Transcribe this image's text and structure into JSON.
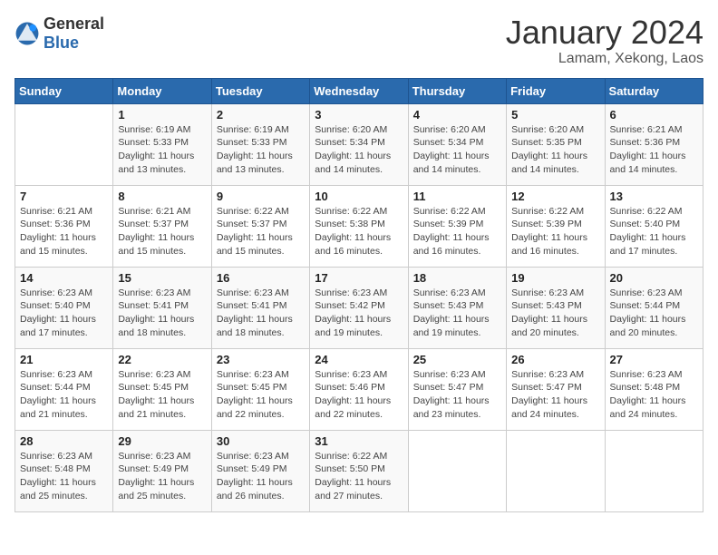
{
  "header": {
    "logo_general": "General",
    "logo_blue": "Blue",
    "month": "January 2024",
    "location": "Lamam, Xekong, Laos"
  },
  "days_of_week": [
    "Sunday",
    "Monday",
    "Tuesday",
    "Wednesday",
    "Thursday",
    "Friday",
    "Saturday"
  ],
  "weeks": [
    [
      {
        "day": "",
        "sunrise": "",
        "sunset": "",
        "daylight": ""
      },
      {
        "day": "1",
        "sunrise": "6:19 AM",
        "sunset": "5:33 PM",
        "daylight": "11 hours and 13 minutes."
      },
      {
        "day": "2",
        "sunrise": "6:19 AM",
        "sunset": "5:33 PM",
        "daylight": "11 hours and 13 minutes."
      },
      {
        "day": "3",
        "sunrise": "6:20 AM",
        "sunset": "5:34 PM",
        "daylight": "11 hours and 14 minutes."
      },
      {
        "day": "4",
        "sunrise": "6:20 AM",
        "sunset": "5:34 PM",
        "daylight": "11 hours and 14 minutes."
      },
      {
        "day": "5",
        "sunrise": "6:20 AM",
        "sunset": "5:35 PM",
        "daylight": "11 hours and 14 minutes."
      },
      {
        "day": "6",
        "sunrise": "6:21 AM",
        "sunset": "5:36 PM",
        "daylight": "11 hours and 14 minutes."
      }
    ],
    [
      {
        "day": "7",
        "sunrise": "6:21 AM",
        "sunset": "5:36 PM",
        "daylight": "11 hours and 15 minutes."
      },
      {
        "day": "8",
        "sunrise": "6:21 AM",
        "sunset": "5:37 PM",
        "daylight": "11 hours and 15 minutes."
      },
      {
        "day": "9",
        "sunrise": "6:22 AM",
        "sunset": "5:37 PM",
        "daylight": "11 hours and 15 minutes."
      },
      {
        "day": "10",
        "sunrise": "6:22 AM",
        "sunset": "5:38 PM",
        "daylight": "11 hours and 16 minutes."
      },
      {
        "day": "11",
        "sunrise": "6:22 AM",
        "sunset": "5:39 PM",
        "daylight": "11 hours and 16 minutes."
      },
      {
        "day": "12",
        "sunrise": "6:22 AM",
        "sunset": "5:39 PM",
        "daylight": "11 hours and 16 minutes."
      },
      {
        "day": "13",
        "sunrise": "6:22 AM",
        "sunset": "5:40 PM",
        "daylight": "11 hours and 17 minutes."
      }
    ],
    [
      {
        "day": "14",
        "sunrise": "6:23 AM",
        "sunset": "5:40 PM",
        "daylight": "11 hours and 17 minutes."
      },
      {
        "day": "15",
        "sunrise": "6:23 AM",
        "sunset": "5:41 PM",
        "daylight": "11 hours and 18 minutes."
      },
      {
        "day": "16",
        "sunrise": "6:23 AM",
        "sunset": "5:41 PM",
        "daylight": "11 hours and 18 minutes."
      },
      {
        "day": "17",
        "sunrise": "6:23 AM",
        "sunset": "5:42 PM",
        "daylight": "11 hours and 19 minutes."
      },
      {
        "day": "18",
        "sunrise": "6:23 AM",
        "sunset": "5:43 PM",
        "daylight": "11 hours and 19 minutes."
      },
      {
        "day": "19",
        "sunrise": "6:23 AM",
        "sunset": "5:43 PM",
        "daylight": "11 hours and 20 minutes."
      },
      {
        "day": "20",
        "sunrise": "6:23 AM",
        "sunset": "5:44 PM",
        "daylight": "11 hours and 20 minutes."
      }
    ],
    [
      {
        "day": "21",
        "sunrise": "6:23 AM",
        "sunset": "5:44 PM",
        "daylight": "11 hours and 21 minutes."
      },
      {
        "day": "22",
        "sunrise": "6:23 AM",
        "sunset": "5:45 PM",
        "daylight": "11 hours and 21 minutes."
      },
      {
        "day": "23",
        "sunrise": "6:23 AM",
        "sunset": "5:45 PM",
        "daylight": "11 hours and 22 minutes."
      },
      {
        "day": "24",
        "sunrise": "6:23 AM",
        "sunset": "5:46 PM",
        "daylight": "11 hours and 22 minutes."
      },
      {
        "day": "25",
        "sunrise": "6:23 AM",
        "sunset": "5:47 PM",
        "daylight": "11 hours and 23 minutes."
      },
      {
        "day": "26",
        "sunrise": "6:23 AM",
        "sunset": "5:47 PM",
        "daylight": "11 hours and 24 minutes."
      },
      {
        "day": "27",
        "sunrise": "6:23 AM",
        "sunset": "5:48 PM",
        "daylight": "11 hours and 24 minutes."
      }
    ],
    [
      {
        "day": "28",
        "sunrise": "6:23 AM",
        "sunset": "5:48 PM",
        "daylight": "11 hours and 25 minutes."
      },
      {
        "day": "29",
        "sunrise": "6:23 AM",
        "sunset": "5:49 PM",
        "daylight": "11 hours and 25 minutes."
      },
      {
        "day": "30",
        "sunrise": "6:23 AM",
        "sunset": "5:49 PM",
        "daylight": "11 hours and 26 minutes."
      },
      {
        "day": "31",
        "sunrise": "6:22 AM",
        "sunset": "5:50 PM",
        "daylight": "11 hours and 27 minutes."
      },
      {
        "day": "",
        "sunrise": "",
        "sunset": "",
        "daylight": ""
      },
      {
        "day": "",
        "sunrise": "",
        "sunset": "",
        "daylight": ""
      },
      {
        "day": "",
        "sunrise": "",
        "sunset": "",
        "daylight": ""
      }
    ]
  ]
}
